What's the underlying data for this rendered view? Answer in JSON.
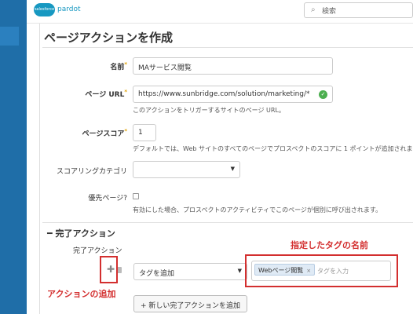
{
  "header": {
    "logo_cloud": "salesforce",
    "logo_product": "pardot",
    "search_placeholder": "検索",
    "search_icon": "search-icon"
  },
  "page": {
    "title": "ページアクションを作成"
  },
  "form": {
    "name": {
      "label": "名前",
      "required_mark": "*",
      "value": "MAサービス閲覧"
    },
    "page_url": {
      "label": "ページ URL",
      "required_mark": "*",
      "value": "https://www.sunbridge.com/solution/marketing/*",
      "help": "このアクションをトリガーするサイトのページ URL。"
    },
    "page_score": {
      "label": "ページスコア",
      "required_mark": "*",
      "value": "1",
      "help": "デフォルトでは、Web サイトのすべてのページでプロスペクトのスコアに 1 ポイントが追加されま"
    },
    "scoring_category": {
      "label": "スコアリングカテゴリ",
      "value": ""
    },
    "priority_page": {
      "label": "優先ページ?",
      "checked": false,
      "help": "有効にした場合、プロスペクトのアクティビティでこのページが個別に呼び出されます。"
    }
  },
  "completion": {
    "section_title": "完了アクション",
    "collapse_icon": "minus",
    "row_label": "完了アクション",
    "action_select": "タグを追加",
    "tag": "Webページ閲覧",
    "tag_remove": "×",
    "tag_placeholder": "タグを入力",
    "add_button": "+ 新しい完了アクションを追加"
  },
  "annotations": {
    "tag_name": "指定したタグの名前",
    "add_action": "アクションの追加",
    "color": "#d32f2f"
  }
}
